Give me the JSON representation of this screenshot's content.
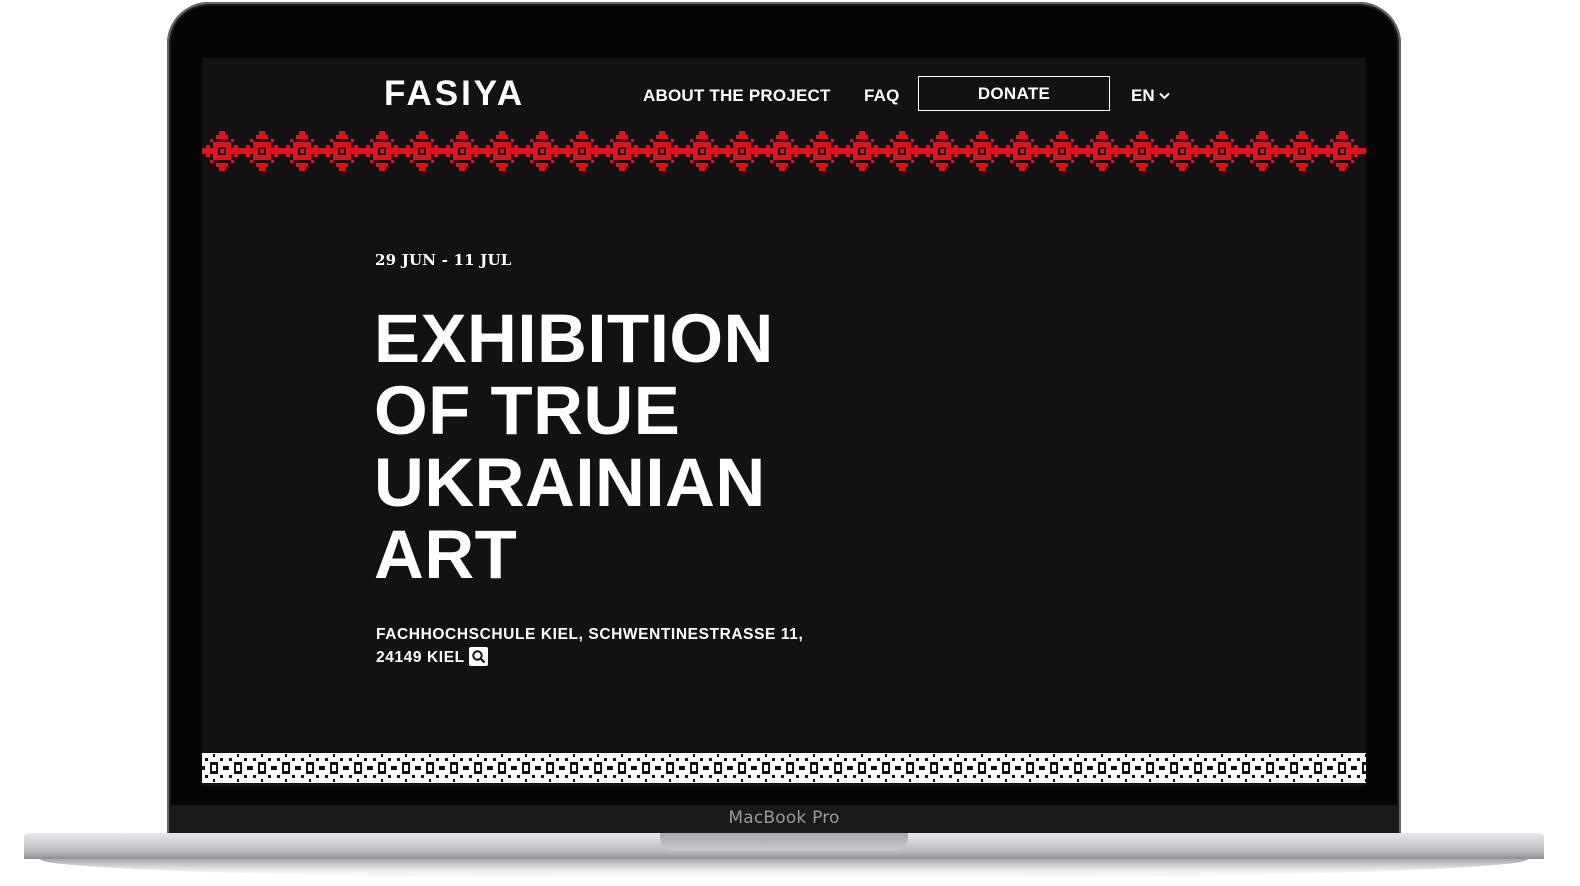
{
  "device": {
    "label": "MacBook Pro"
  },
  "header": {
    "logo": "FASIYA",
    "nav": {
      "about": "ABOUT THE PROJECT",
      "faq": "FAQ"
    },
    "donate": "DONATE",
    "language": "EN"
  },
  "hero": {
    "dates": "29 JUN - 11 JUL",
    "title_lines": [
      "EXHIBITION",
      "OF TRUE",
      "UKRAINIAN",
      "ART"
    ],
    "address_line1": "FACHHOCHSCHULE KIEL, SCHWENTINESTRASSE 11,",
    "address_line2": "24149 KIEL"
  },
  "colors": {
    "background": "#121212",
    "text": "#ffffff",
    "ornament_top": "#e3101c",
    "ornament_bottom": "#ffffff"
  },
  "icons": {
    "language_caret": "chevron-down-icon",
    "address_search": "search-icon"
  }
}
